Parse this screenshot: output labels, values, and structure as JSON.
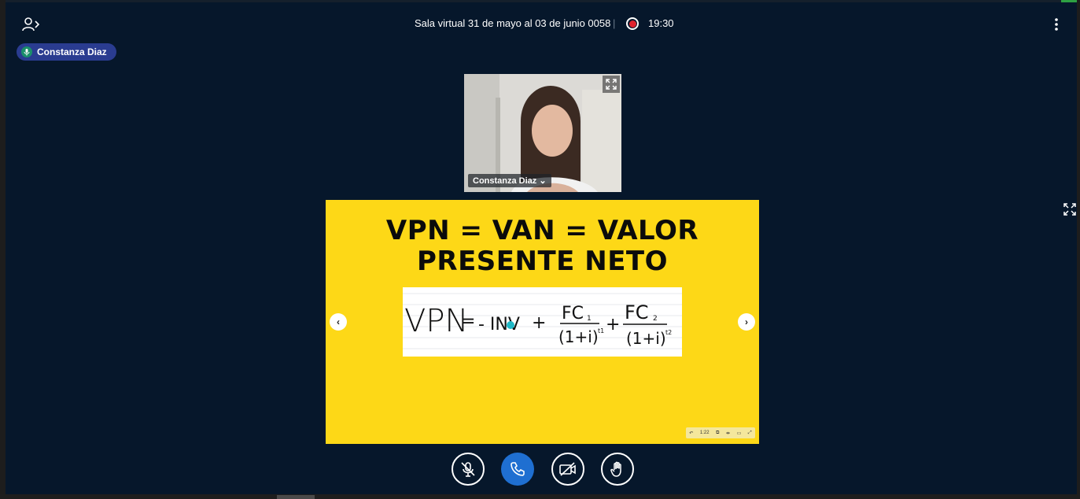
{
  "window": {
    "accent": "#2ea043"
  },
  "header": {
    "title": "Sala virtual 31 de mayo al 03 de junio 0058",
    "separator": "|",
    "recording_time": "19:30",
    "recording_color": "#e0232e"
  },
  "talking_indicator": {
    "name": "Constanza Diaz",
    "icon": "microphone-icon"
  },
  "webcam": {
    "name_label": "Constanza Diaz",
    "icon": "expand-icon"
  },
  "presentation": {
    "title_line1": "VPN = VAN = VALOR",
    "title_line2": "PRESENTE NETO",
    "background": "#fdd817",
    "formula_parts": {
      "lhs": "VPN",
      "eq": "=",
      "term0": "- INV",
      "plus1": "+",
      "num1": "FC",
      "num1_sub": "1",
      "den1": "(1+i)",
      "den1_sup": "t1",
      "plus2": "+",
      "num2": "FC",
      "num2_sub": "2",
      "den2": "(1+i)",
      "den2_sup": "t2"
    },
    "prev_glyph": "‹",
    "next_glyph": "›",
    "toolbar": {
      "undo": "↶",
      "zoom": "1:22",
      "pages": "⧉",
      "fit": "⇹",
      "tools": "▭",
      "fullscreen": "⤢"
    }
  },
  "controls": {
    "mic": {
      "icon": "microphone-muted-icon"
    },
    "phone": {
      "icon": "phone-icon",
      "color": "#1f6fd1"
    },
    "camera": {
      "icon": "camera-off-icon"
    },
    "hand": {
      "icon": "raise-hand-icon"
    }
  }
}
